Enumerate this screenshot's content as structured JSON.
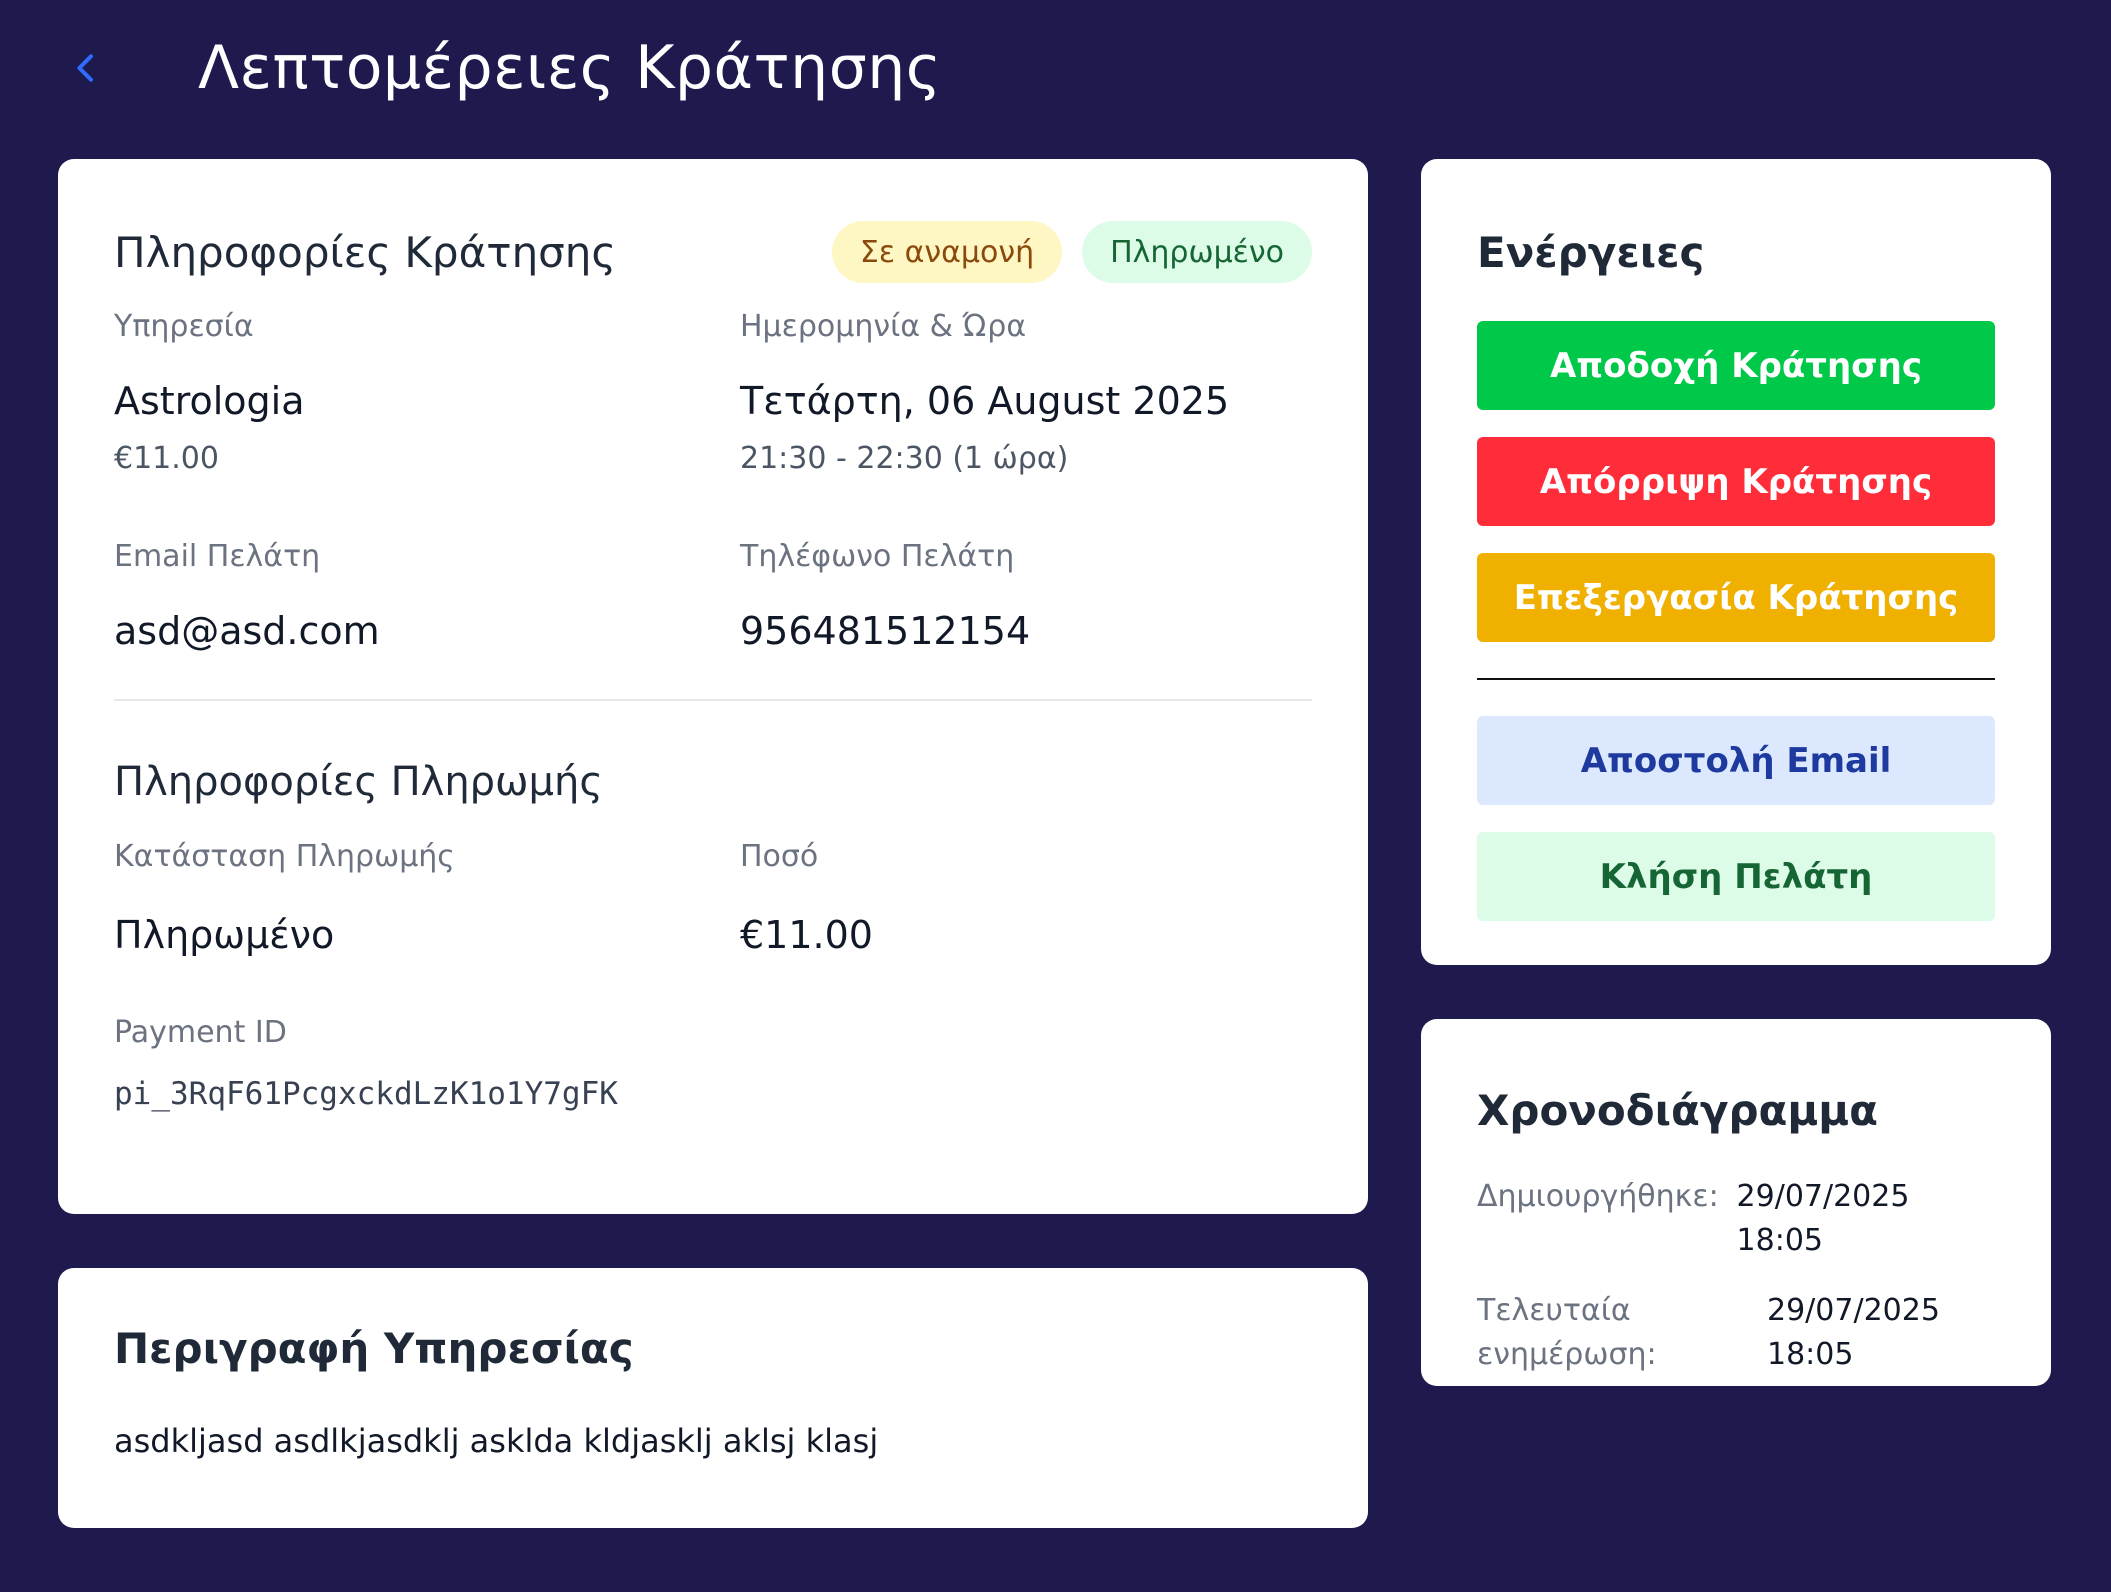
{
  "header": {
    "title": "Λεπτομέρειες Κράτησης",
    "back_icon": "chevron-left-icon",
    "accent": "#2f6bff"
  },
  "booking": {
    "title": "Πληροφορίες Κράτησης",
    "badges": {
      "status": "Σε αναμονή",
      "payment": "Πληρωμένο"
    },
    "service_label": "Υπηρεσία",
    "service_value": "Astrologia",
    "service_price": "€11.00",
    "datetime_label": "Ημερομηνία & Ώρα",
    "datetime_value": "Τετάρτη, 06 August 2025",
    "datetime_range": "21:30 - 22:30 (1 ώρα)",
    "email_label": "Email Πελάτη",
    "email_value": "asd@asd.com",
    "phone_label": "Τηλέφωνο Πελάτη",
    "phone_value": "956481512154"
  },
  "payment": {
    "title": "Πληροφορίες Πληρωμής",
    "status_label": "Κατάσταση Πληρωμής",
    "status_value": "Πληρωμένο",
    "amount_label": "Ποσό",
    "amount_value": "€11.00",
    "id_label": "Payment ID",
    "id_value": "pi_3RqF61PcgxckdLzK1o1Y7gFK"
  },
  "description": {
    "title": "Περιγραφή Υπηρεσίας",
    "text": "asdkljasd asdlkjasdklj asklda kldjasklj aklsj klasj"
  },
  "actions": {
    "title": "Ενέργειες",
    "accept": "Αποδοχή Κράτησης",
    "reject": "Απόρριψη Κράτησης",
    "edit": "Επεξεργασία Κράτησης",
    "email": "Αποστολή Email",
    "call": "Κλήση Πελάτη"
  },
  "timeline": {
    "title": "Χρονοδιάγραμμα",
    "created_label": "Δημιουργήθηκε:",
    "created_value": "29/07/2025 18:05",
    "updated_label_1": "Τελευταία",
    "updated_label_2": "ενημέρωση:",
    "updated_value_1": "29/07/2025",
    "updated_value_2": "18:05"
  }
}
